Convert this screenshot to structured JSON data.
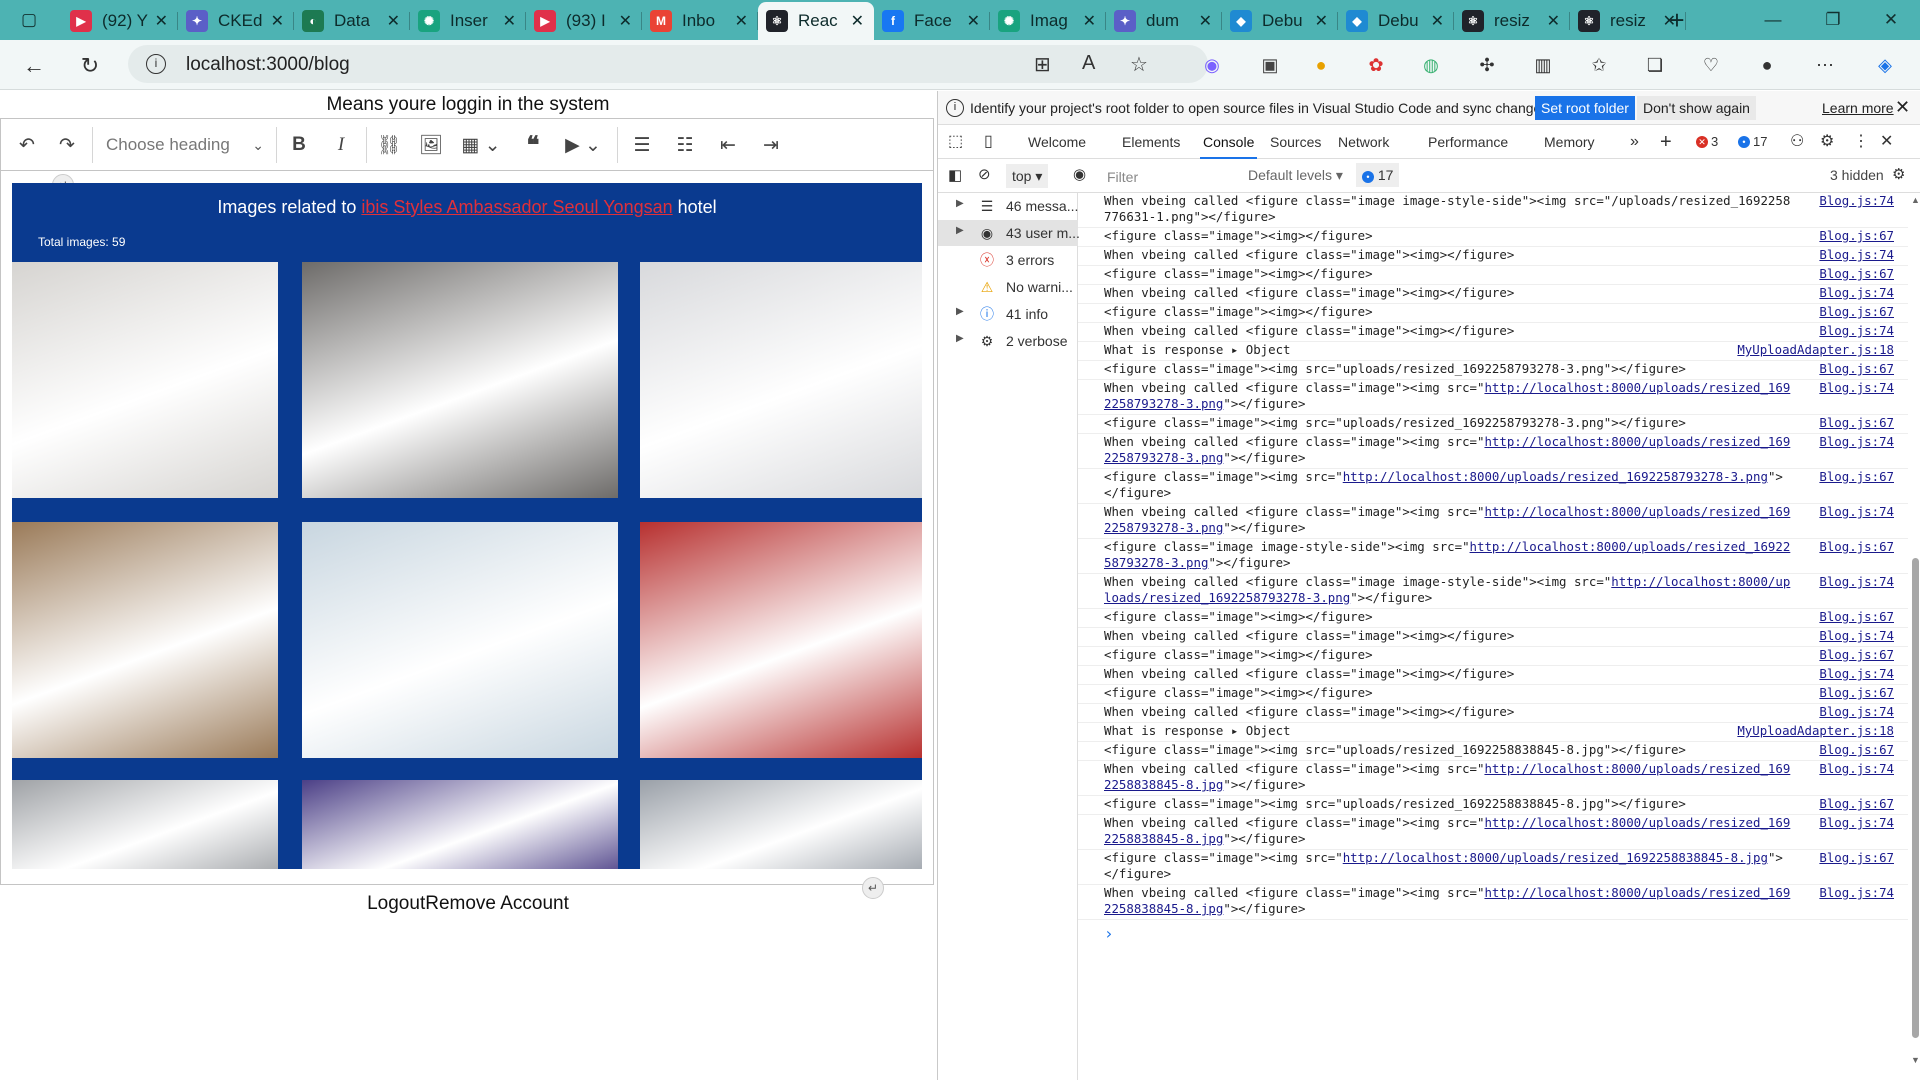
{
  "browser": {
    "tabs": [
      {
        "label": "(92) Y",
        "fav": "youtube-icon",
        "color": "#e0304a",
        "glyph": "▶"
      },
      {
        "label": "CKEd",
        "fav": "ckeditor-icon",
        "color": "#5b5fc7",
        "glyph": "✦"
      },
      {
        "label": "Data",
        "fav": "data-icon",
        "color": "#1d7a52",
        "glyph": "◐"
      },
      {
        "label": "Inser",
        "fav": "chatgpt-icon",
        "color": "#19a37f",
        "glyph": "✺"
      },
      {
        "label": "(93) I",
        "fav": "youtube-icon",
        "color": "#e0304a",
        "glyph": "▶"
      },
      {
        "label": "Inbo",
        "fav": "gmail-icon",
        "color": "#ea4335",
        "glyph": "M"
      },
      {
        "label": "Reac",
        "fav": "react-icon",
        "color": "#20232a",
        "glyph": "⚛",
        "active": true
      },
      {
        "label": "Face",
        "fav": "facebook-icon",
        "color": "#1877f2",
        "glyph": "f"
      },
      {
        "label": "Imag",
        "fav": "chatgpt-icon",
        "color": "#19a37f",
        "glyph": "✺"
      },
      {
        "label": "dum",
        "fav": "ckeditor-icon",
        "color": "#5b5fc7",
        "glyph": "✦"
      },
      {
        "label": "Debu",
        "fav": "vscode-icon",
        "color": "#1f8ad2",
        "glyph": "◆"
      },
      {
        "label": "Debu",
        "fav": "vscode-icon",
        "color": "#1f8ad2",
        "glyph": "◆"
      },
      {
        "label": "resiz",
        "fav": "react-icon",
        "color": "#20232a",
        "glyph": "⚛"
      },
      {
        "label": "resiz",
        "fav": "react-icon",
        "color": "#20232a",
        "glyph": "⚛"
      }
    ],
    "url": "localhost:3000/blog"
  },
  "page": {
    "title": "Means youre loggin in the system",
    "heading_select": "Choose heading",
    "images_prefix": "Images related to",
    "hotel_link": "ibis Styles Ambassador Seoul Yongsan",
    "images_suffix": "hotel",
    "total_images": "Total images: 59",
    "logout": "Logout",
    "remove_account": "Remove Account",
    "photo_colors": [
      "#d6d4d1",
      "#6d6b69",
      "#d8d9dc",
      "#9a7a58",
      "#c8d6e0",
      "#b7302f",
      "#9fa2a6",
      "#4b3f86",
      "#9aa0a8"
    ]
  },
  "devtools": {
    "notice": "Identify your project's root folder to open source files in Visual Studio Code and sync changes.",
    "set_root": "Set root folder",
    "dont_show": "Don't show again",
    "learn_more": "Learn more",
    "tabs": [
      "Welcome",
      "Elements",
      "Console",
      "Sources",
      "Network",
      "Performance",
      "Memory"
    ],
    "active_tab": "Console",
    "errors_count": "3",
    "info_count": "17",
    "context": "top",
    "filter_placeholder": "Filter",
    "levels": "Default levels",
    "issues_count": "17",
    "hidden": "3 hidden",
    "sidebar": [
      {
        "label": "46 messa...",
        "icon": "list-icon"
      },
      {
        "label": "43 user m...",
        "icon": "user-icon",
        "selected": true
      },
      {
        "label": "3 errors",
        "icon": "error-icon"
      },
      {
        "label": "No warni...",
        "icon": "warning-icon"
      },
      {
        "label": "41 info",
        "icon": "info-icon"
      },
      {
        "label": "2 verbose",
        "icon": "verbose-icon"
      }
    ],
    "logs": [
      {
        "pre": "When vbeing called <figure class=\"image image-style-side\"><img src=\"/uploads/resized_1692258776631-1.png\"></figure>",
        "src": "Blog.js:74"
      },
      {
        "pre": "<figure class=\"image\"><img></figure>",
        "src": "Blog.js:67"
      },
      {
        "pre": "When vbeing called <figure class=\"image\"><img></figure>",
        "src": "Blog.js:74"
      },
      {
        "pre": "<figure class=\"image\"><img></figure>",
        "src": "Blog.js:67"
      },
      {
        "pre": "When vbeing called <figure class=\"image\"><img></figure>",
        "src": "Blog.js:74"
      },
      {
        "pre": "<figure class=\"image\"><img></figure>",
        "src": "Blog.js:67"
      },
      {
        "pre": "When vbeing called <figure class=\"image\"><img></figure>",
        "src": "Blog.js:74"
      },
      {
        "pre": "What is response ▸ Object",
        "src": "MyUploadAdapter.js:18"
      },
      {
        "pre": "<figure class=\"image\"><img src=\"uploads/resized_1692258793278-3.png\"></figure>",
        "src": "Blog.js:67"
      },
      {
        "pre": "When vbeing called <figure class=\"image\"><img src=\"",
        "link": "http://localhost:8000/uploads/resized_1692258793278-3.png",
        "post": "\"></figure>",
        "src": "Blog.js:74"
      },
      {
        "pre": "<figure class=\"image\"><img src=\"uploads/resized_1692258793278-3.png\"></figure>",
        "src": "Blog.js:67"
      },
      {
        "pre": "When vbeing called <figure class=\"image\"><img src=\"",
        "link": "http://localhost:8000/uploads/resized_1692258793278-3.png",
        "post": "\"></figure>",
        "src": "Blog.js:74"
      },
      {
        "pre": "<figure class=\"image\"><img src=\"",
        "link": "http://localhost:8000/uploads/resized_1692258793278-3.png",
        "post": "\"></figure>",
        "src": "Blog.js:67"
      },
      {
        "pre": "When vbeing called <figure class=\"image\"><img src=\"",
        "link": "http://localhost:8000/uploads/resized_1692258793278-3.png",
        "post": "\"></figure>",
        "src": "Blog.js:74"
      },
      {
        "pre": "<figure class=\"image image-style-side\"><img src=\"",
        "link": "http://localhost:8000/uploads/resized_1692258793278-3.png",
        "post": "\"></figure>",
        "src": "Blog.js:67"
      },
      {
        "pre": "When vbeing called <figure class=\"image image-style-side\"><img src=\"",
        "link": "http://localhost:8000/uploads/resized_1692258793278-3.png",
        "post": "\"></figure>",
        "src": "Blog.js:74"
      },
      {
        "pre": "<figure class=\"image\"><img></figure>",
        "src": "Blog.js:67"
      },
      {
        "pre": "When vbeing called <figure class=\"image\"><img></figure>",
        "src": "Blog.js:74"
      },
      {
        "pre": "<figure class=\"image\"><img></figure>",
        "src": "Blog.js:67"
      },
      {
        "pre": "When vbeing called <figure class=\"image\"><img></figure>",
        "src": "Blog.js:74"
      },
      {
        "pre": "<figure class=\"image\"><img></figure>",
        "src": "Blog.js:67"
      },
      {
        "pre": "When vbeing called <figure class=\"image\"><img></figure>",
        "src": "Blog.js:74"
      },
      {
        "pre": "What is response ▸ Object",
        "src": "MyUploadAdapter.js:18"
      },
      {
        "pre": "<figure class=\"image\"><img src=\"uploads/resized_1692258838845-8.jpg\"></figure>",
        "src": "Blog.js:67"
      },
      {
        "pre": "When vbeing called <figure class=\"image\"><img src=\"",
        "link": "http://localhost:8000/uploads/resized_1692258838845-8.jpg",
        "post": "\"></figure>",
        "src": "Blog.js:74"
      },
      {
        "pre": "<figure class=\"image\"><img src=\"uploads/resized_1692258838845-8.jpg\"></figure>",
        "src": "Blog.js:67"
      },
      {
        "pre": "When vbeing called <figure class=\"image\"><img src=\"",
        "link": "http://localhost:8000/uploads/resized_1692258838845-8.jpg",
        "post": "\"></figure>",
        "src": "Blog.js:74"
      },
      {
        "pre": "<figure class=\"image\"><img src=\"",
        "link": "http://localhost:8000/uploads/resized_1692258838845-8.jpg",
        "post": "\"></figure>",
        "src": "Blog.js:67"
      },
      {
        "pre": "When vbeing called <figure class=\"image\"><img src=\"",
        "link": "http://localhost:8000/uploads/resized_1692258838845-8.jpg",
        "post": "\"></figure>",
        "src": "Blog.js:74"
      }
    ]
  }
}
